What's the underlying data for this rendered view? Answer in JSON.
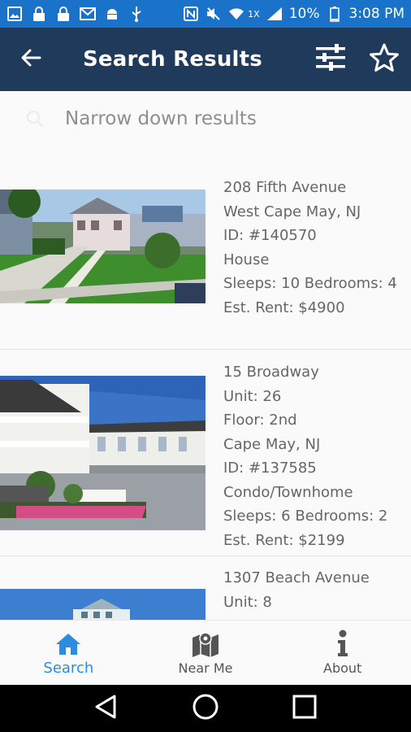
{
  "status_bar": {
    "battery": "10%",
    "time": "3:08 PM",
    "network": "1X"
  },
  "app_bar": {
    "title": "Search Results"
  },
  "search": {
    "placeholder": "Narrow down results"
  },
  "listings": [
    {
      "lines": [
        "208 Fifth Avenue",
        "West Cape May, NJ",
        "ID: #140570",
        "House",
        "Sleeps: 10  Bedrooms: 4",
        "Est. Rent: $4900"
      ]
    },
    {
      "lines": [
        "15 Broadway",
        "Unit: 26",
        "Floor: 2nd",
        "Cape May, NJ",
        "ID: #137585",
        "Condo/Townhome",
        "Sleeps: 6  Bedrooms: 2",
        "Est. Rent: $2199"
      ]
    },
    {
      "lines": [
        "1307 Beach Avenue",
        "Unit: 8"
      ]
    }
  ],
  "bottom_nav": [
    {
      "label": "Search",
      "icon": "home-icon",
      "active": true
    },
    {
      "label": "Near Me",
      "icon": "map-icon",
      "active": false
    },
    {
      "label": "About",
      "icon": "info-icon",
      "active": false
    }
  ],
  "colors": {
    "status_bar": "#1a73c9",
    "app_bar": "#1f3a5b",
    "accent": "#2c8de0"
  }
}
